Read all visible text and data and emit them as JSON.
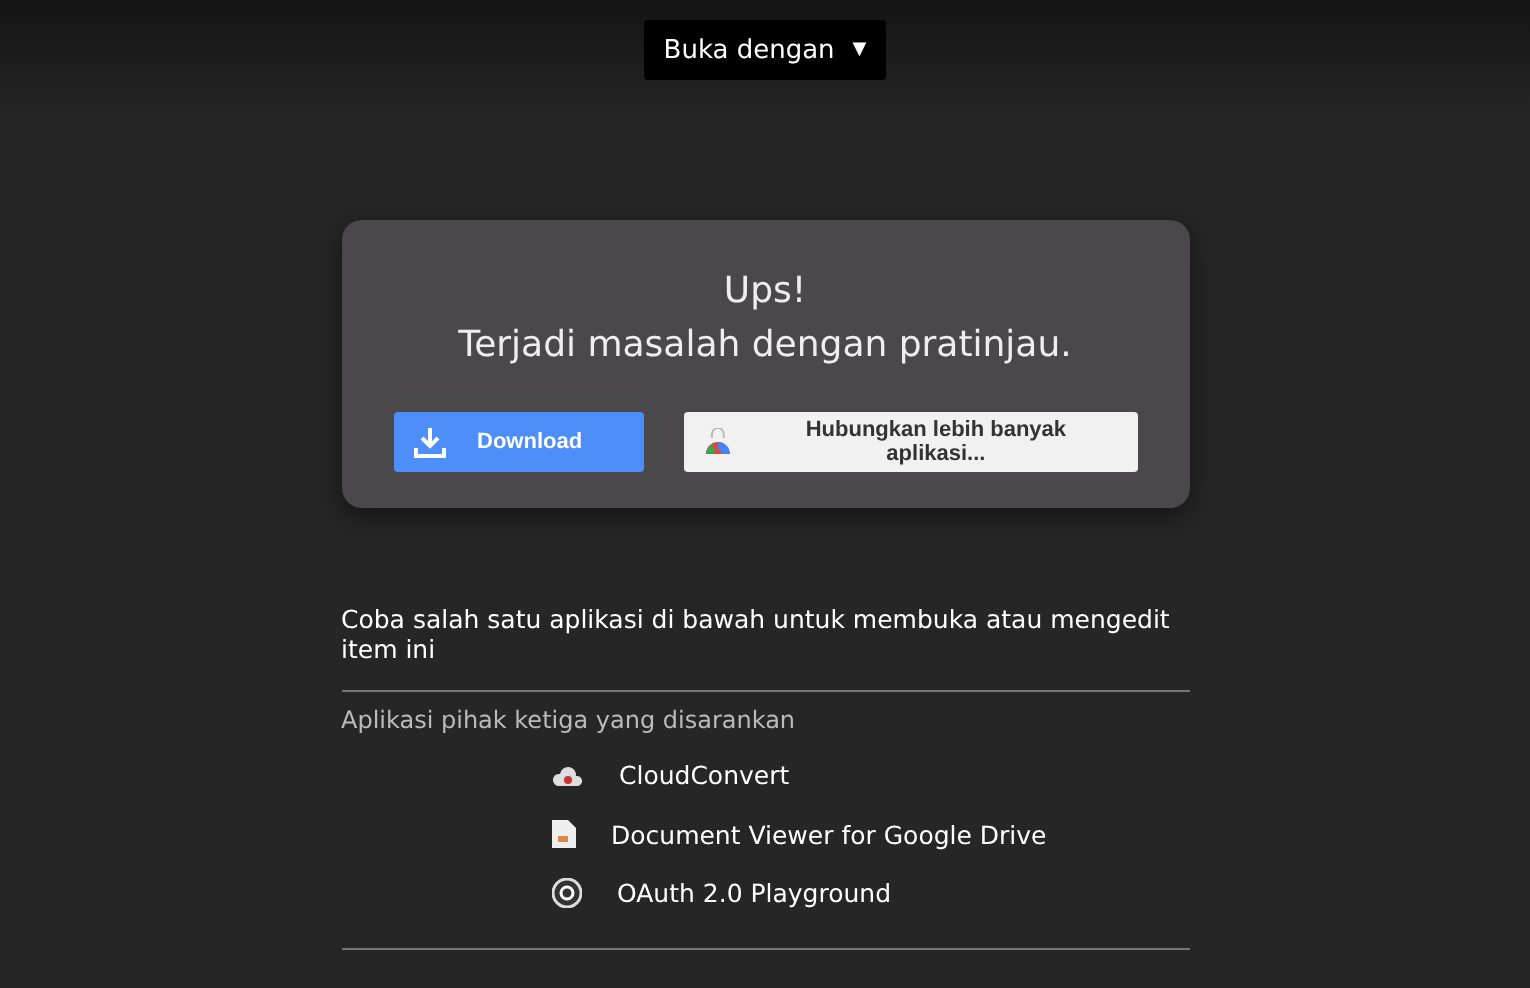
{
  "open_with": {
    "label": "Buka dengan",
    "caret": "▼"
  },
  "error_card": {
    "title": "Ups!",
    "message": "Terjadi masalah dengan pratinjau.",
    "buttons": [
      {
        "kind": "download",
        "label": "Download"
      },
      {
        "kind": "connect",
        "label": "Hubungkan lebih banyak aplikasi..."
      }
    ]
  },
  "hint": "Coba salah satu aplikasi di bawah untuk membuka atau mengedit item ini",
  "suggested": {
    "heading": "Aplikasi pihak ketiga yang disarankan",
    "apps": [
      {
        "kind": "cloud",
        "name": "CloudConvert"
      },
      {
        "kind": "document",
        "name": "Document Viewer for Google Drive"
      },
      {
        "kind": "badge",
        "name": "OAuth 2.0 Playground"
      }
    ]
  }
}
